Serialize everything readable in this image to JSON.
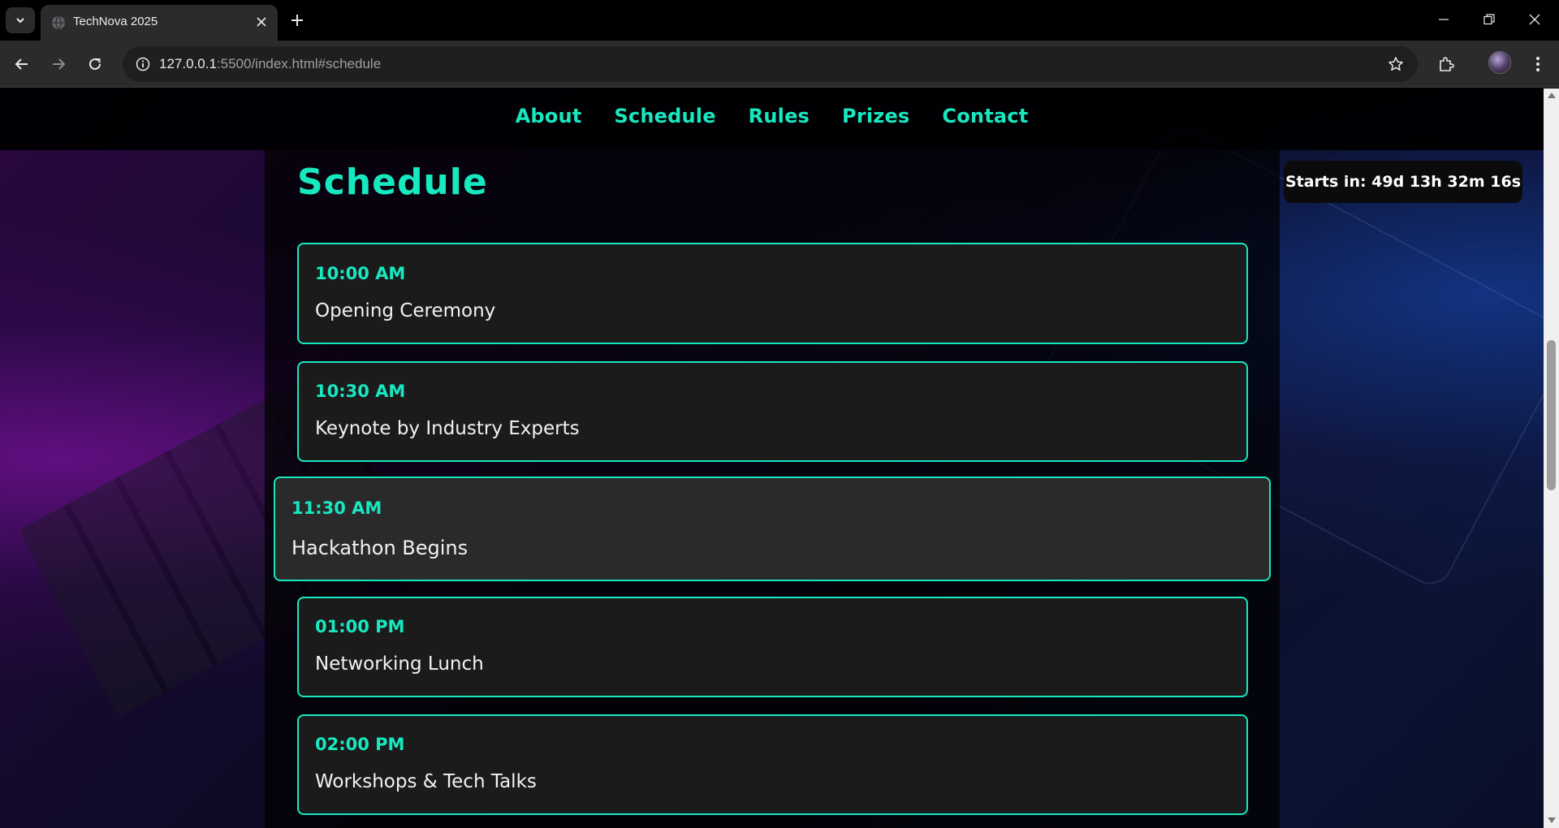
{
  "browser": {
    "tab_title": "TechNova 2025",
    "url_host": "127.0.0.1",
    "url_rest": ":5500/index.html#schedule"
  },
  "nav": {
    "links": [
      "About",
      "Schedule",
      "Rules",
      "Prizes",
      "Contact"
    ]
  },
  "section": {
    "title": "Schedule"
  },
  "countdown": {
    "text": "Starts in: 49d 13h 32m 16s"
  },
  "schedule": [
    {
      "time": "10:00 AM",
      "event": "Opening Ceremony"
    },
    {
      "time": "10:30 AM",
      "event": "Keynote by Industry Experts"
    },
    {
      "time": "11:30 AM",
      "event": "Hackathon Begins"
    },
    {
      "time": "01:00 PM",
      "event": "Networking Lunch"
    },
    {
      "time": "02:00 PM",
      "event": "Workshops & Tech Talks"
    }
  ],
  "colors": {
    "accent": "#17e8c0",
    "card_bg": "#1b1b1c",
    "card_hover_bg": "#2a2a2b",
    "nav_bg": "#000000"
  },
  "icons": [
    "tab-search-icon",
    "globe-icon",
    "close-icon",
    "plus-icon",
    "minimize-icon",
    "restore-icon",
    "back-icon",
    "forward-icon",
    "reload-icon",
    "info-icon",
    "star-icon",
    "extensions-icon",
    "kebab-menu-icon"
  ]
}
